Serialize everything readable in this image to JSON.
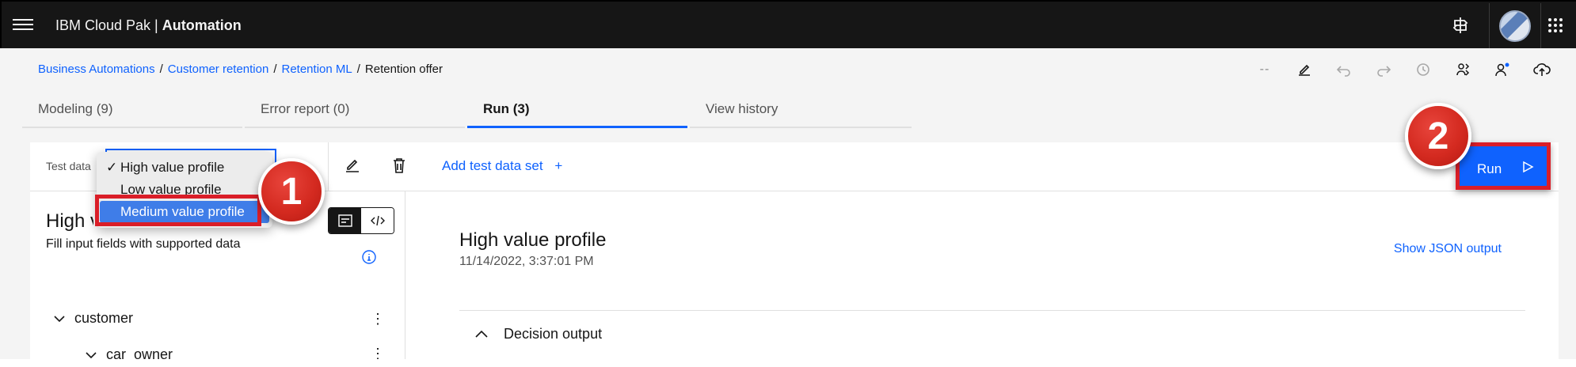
{
  "app": {
    "brand_prefix": "IBM Cloud Pak | ",
    "brand_bold": "Automation"
  },
  "breadcrumb": {
    "items": [
      "Business Automations",
      "Customer retention",
      "Retention ML"
    ],
    "separator": "/",
    "current": "Retention offer"
  },
  "toolbar": {
    "dash_label": "--"
  },
  "tabs": [
    {
      "label": "Modeling (9)"
    },
    {
      "label": "Error report (0)"
    },
    {
      "label": "Run (3)"
    },
    {
      "label": "View history"
    }
  ],
  "test_data": {
    "label": "Test data",
    "add_label": "Add test data set",
    "add_icon": "+",
    "run_label": "Run"
  },
  "dropdown": {
    "options": [
      "High value profile",
      "Low value profile",
      "Medium value profile"
    ],
    "check": "✓"
  },
  "left_panel": {
    "title": "High value profile",
    "subtitle": "Fill input fields with supported data",
    "tree": [
      "customer",
      "car_owner"
    ]
  },
  "right_panel": {
    "title": "High value profile",
    "date": "11/14/2022, 3:37:01 PM",
    "json_link": "Show JSON output",
    "output_label": "Decision output"
  },
  "annotations": {
    "step1": "1",
    "step2": "2"
  },
  "colors": {
    "accent": "#0f62fe",
    "highlight": "#da1e28",
    "topbar": "#161616"
  }
}
